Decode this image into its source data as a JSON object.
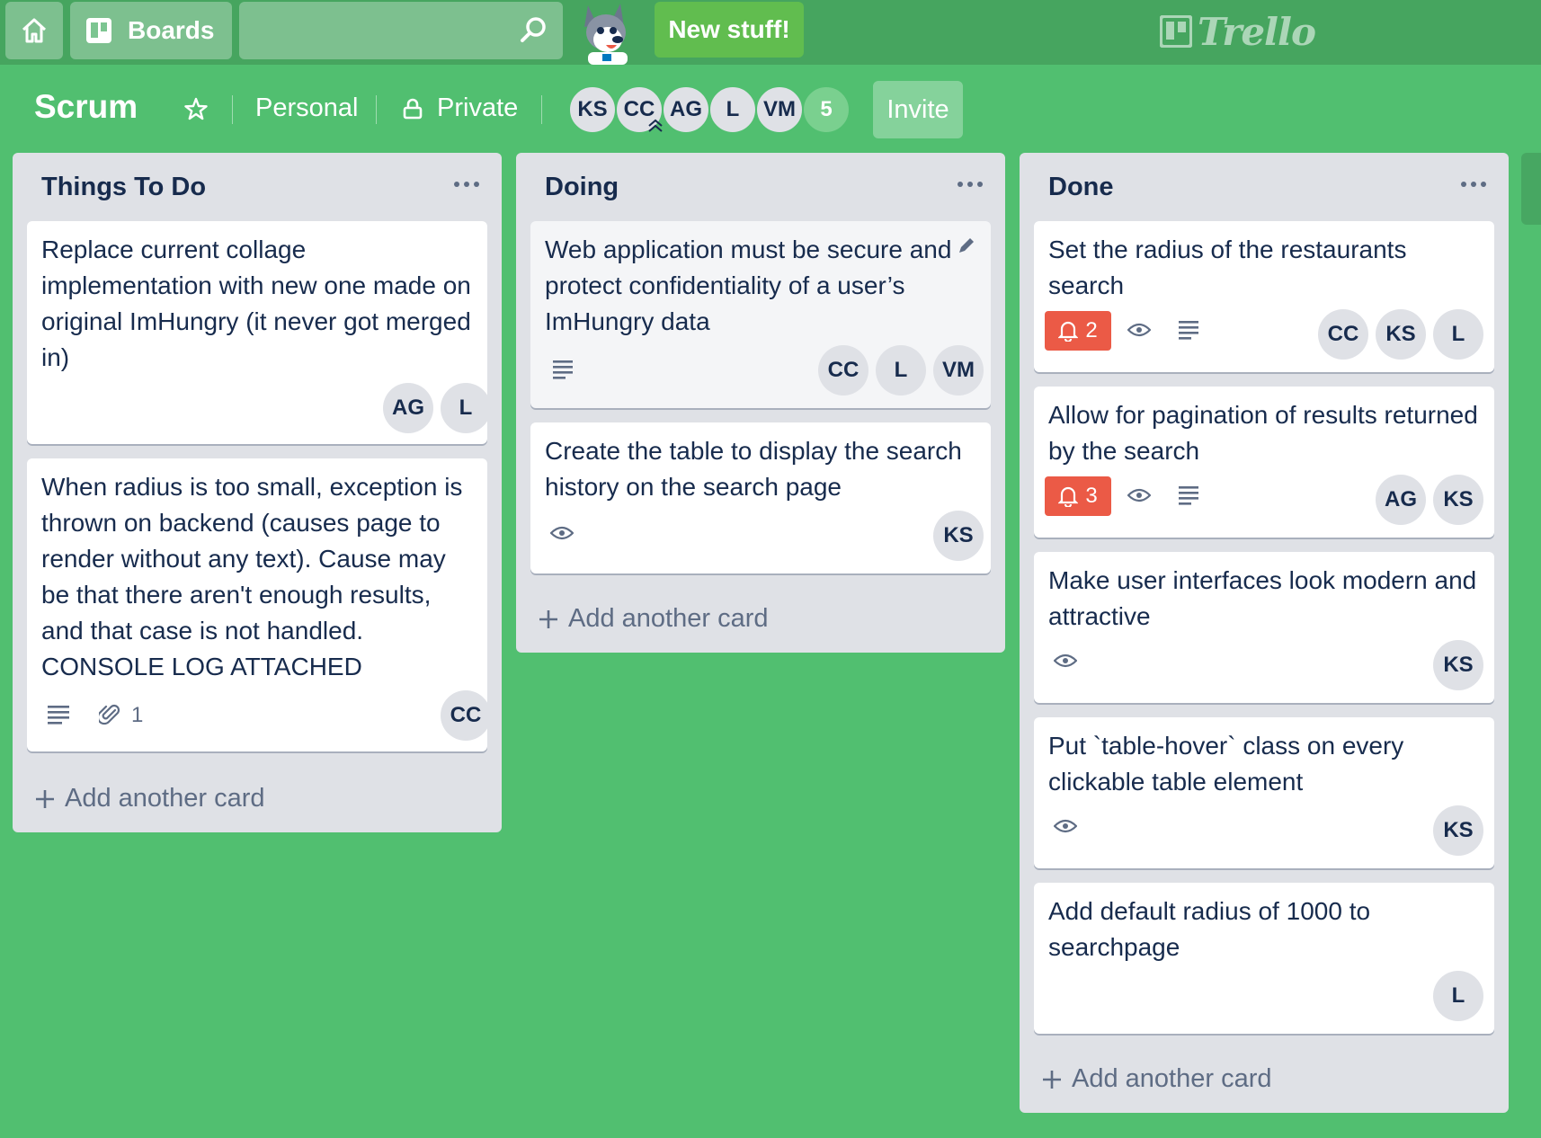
{
  "header": {
    "boards_label": "Boards",
    "search_value": "",
    "new_stuff_label": "New stuff!",
    "logo_text": "Trello"
  },
  "board": {
    "title": "Scrum",
    "visibility_team": "Personal",
    "visibility_privacy": "Private",
    "members": [
      "KS",
      "CC",
      "AG",
      "L",
      "VM"
    ],
    "more_members": "5",
    "invite_label": "Invite"
  },
  "lists": [
    {
      "title": "Things To Do",
      "add_card_label": "Add another card",
      "cards": [
        {
          "text": "Replace current collage implementation with new one made on original ImHungry (it never got merged in)",
          "members": [
            "AG",
            "L"
          ]
        },
        {
          "text": "When radius is too small, exception is thrown on backend (causes page to render without any text). Cause may be that there aren't enough results, and that case is not handled. CONSOLE LOG ATTACHED",
          "attachments": "1",
          "members": [
            "CC"
          ]
        }
      ]
    },
    {
      "title": "Doing",
      "add_card_label": "Add another card",
      "cards": [
        {
          "text": "Web application must be secure and protect confidentiality of a user’s ImHungry data",
          "members": [
            "CC",
            "L",
            "VM"
          ]
        },
        {
          "text": "Create the table to display the search history on the search page",
          "members": [
            "KS"
          ]
        }
      ]
    },
    {
      "title": "Done",
      "add_card_label": "Add another card",
      "cards": [
        {
          "text": "Set the radius of the restaurants search",
          "notifications": "2",
          "members": [
            "CC",
            "KS",
            "L"
          ]
        },
        {
          "text": "Allow for pagination of results returned by the search",
          "notifications": "3",
          "members": [
            "AG",
            "KS"
          ]
        },
        {
          "text": "Make user interfaces look modern and attractive",
          "members": [
            "KS"
          ]
        },
        {
          "text": "Put `table-hover` class on every clickable table element",
          "members": [
            "KS"
          ]
        },
        {
          "text": "Add default radius of 1000 to searchpage",
          "members": [
            "L"
          ]
        }
      ]
    }
  ],
  "colors": {
    "board_bg": "#51bf70",
    "header_bg": "#46a55f",
    "list_bg": "#dfe1e6",
    "notification_red": "#eb5a46"
  }
}
